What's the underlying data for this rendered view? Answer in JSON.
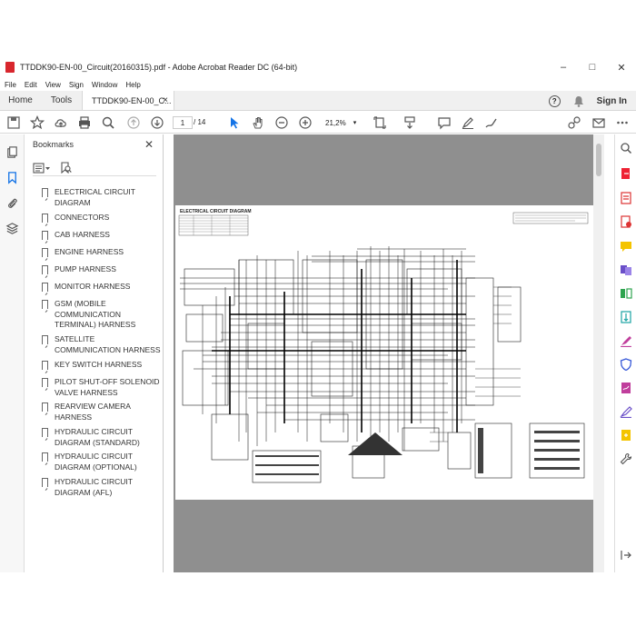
{
  "window": {
    "title": "TTDDK90-EN-00_Circuit(20160315).pdf - Adobe Acrobat Reader DC (64-bit)",
    "controls": [
      "–",
      "□",
      "✕"
    ]
  },
  "menu": [
    "File",
    "Edit",
    "View",
    "Sign",
    "Window",
    "Help"
  ],
  "tabs": {
    "home": "Home",
    "tools": "Tools",
    "document": "TTDDK90-EN-00_C...",
    "close": "×",
    "help": "?",
    "signin": "Sign In"
  },
  "toolbar": {
    "page_current": "1",
    "page_total": "/ 14",
    "zoom": "21,2%",
    "zoom_caret": "▾"
  },
  "bookmarks": {
    "title": "Bookmarks",
    "close": "✕",
    "items": [
      "ELECTRICAL CIRCUIT DIAGRAM",
      "CONNECTORS",
      "CAB HARNESS",
      "ENGINE HARNESS",
      "PUMP HARNESS",
      "MONITOR HARNESS",
      "GSM (MOBILE COMMUNICATION TERMINAL) HARNESS",
      "SATELLITE COMMUNICATION HARNESS",
      "KEY SWITCH HARNESS",
      "PILOT SHUT-OFF SOLENOID VALVE HARNESS",
      "REARVIEW CAMERA HARNESS",
      "HYDRAULIC CIRCUIT DIAGRAM (STANDARD)",
      "HYDRAULIC CIRCUIT DIAGRAM (OPTIONAL)",
      "HYDRAULIC CIRCUIT DIAGRAM (AFL)"
    ]
  },
  "document_page": {
    "heading": "ELECTRICAL CIRCUIT DIAGRAM"
  },
  "colors": {
    "pdf_red": "#d8262d",
    "viewer_gray": "#8f8f8f",
    "accent_blue": "#1473e6"
  }
}
